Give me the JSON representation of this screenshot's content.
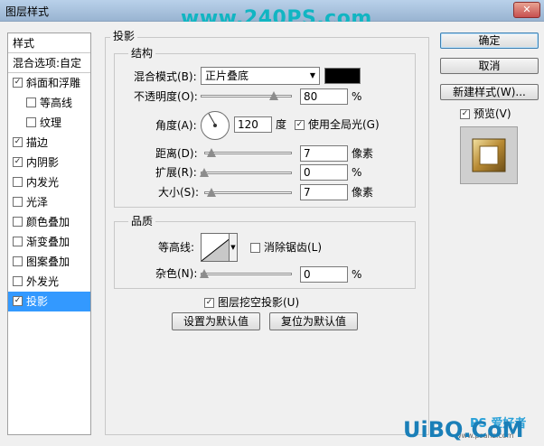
{
  "window": {
    "title": "图层样式",
    "close_glyph": "✕",
    "watermark": "www.240PS.com"
  },
  "style_list": {
    "header": "样式",
    "blend_options": "混合选项:自定",
    "items": [
      {
        "label": "斜面和浮雕",
        "checked": true,
        "indent": false,
        "selected": false
      },
      {
        "label": "等高线",
        "checked": false,
        "indent": true,
        "selected": false
      },
      {
        "label": "纹理",
        "checked": false,
        "indent": true,
        "selected": false
      },
      {
        "label": "描边",
        "checked": true,
        "indent": false,
        "selected": false
      },
      {
        "label": "内阴影",
        "checked": true,
        "indent": false,
        "selected": false
      },
      {
        "label": "内发光",
        "checked": false,
        "indent": false,
        "selected": false
      },
      {
        "label": "光泽",
        "checked": false,
        "indent": false,
        "selected": false
      },
      {
        "label": "颜色叠加",
        "checked": false,
        "indent": false,
        "selected": false
      },
      {
        "label": "渐变叠加",
        "checked": false,
        "indent": false,
        "selected": false
      },
      {
        "label": "图案叠加",
        "checked": false,
        "indent": false,
        "selected": false
      },
      {
        "label": "外发光",
        "checked": false,
        "indent": false,
        "selected": false
      },
      {
        "label": "投影",
        "checked": true,
        "indent": false,
        "selected": true
      }
    ]
  },
  "panel": {
    "title": "投影",
    "structure": {
      "title": "结构",
      "blend_mode_label": "混合模式(B):",
      "blend_mode_value": "正片叠底",
      "shadow_color": "#000000",
      "opacity_label": "不透明度(O):",
      "opacity_value": "80",
      "opacity_unit": "%",
      "opacity_level": 0.8,
      "angle_label": "角度(A):",
      "angle_value": "120",
      "angle_unit": "度",
      "global_light_label": "使用全局光(G)",
      "global_light_checked": true,
      "distance_label": "距离(D):",
      "distance_value": "7",
      "distance_unit": "像素",
      "spread_label": "扩展(R):",
      "spread_value": "0",
      "spread_unit": "%",
      "size_label": "大小(S):",
      "size_value": "7",
      "size_unit": "像素"
    },
    "quality": {
      "title": "品质",
      "contour_label": "等高线:",
      "anti_alias_label": "消除锯齿(L)",
      "anti_alias_checked": false,
      "noise_label": "杂色(N):",
      "noise_value": "0",
      "noise_unit": "%"
    },
    "knockout_label": "图层挖空投影(U)",
    "knockout_checked": true,
    "make_default_label": "设置为默认值",
    "reset_default_label": "复位为默认值"
  },
  "right": {
    "ok_label": "确定",
    "cancel_label": "取消",
    "new_style_label": "新建样式(W)...",
    "preview_label": "预览(V)",
    "preview_checked": true
  },
  "footer": {
    "watermark_ps": "PS 爱好者",
    "watermark_site": "UiBQ.CoM",
    "watermark_small": "www.psahz.com"
  },
  "icons": {
    "check": "✓",
    "dropdown_arrow": "▼"
  }
}
